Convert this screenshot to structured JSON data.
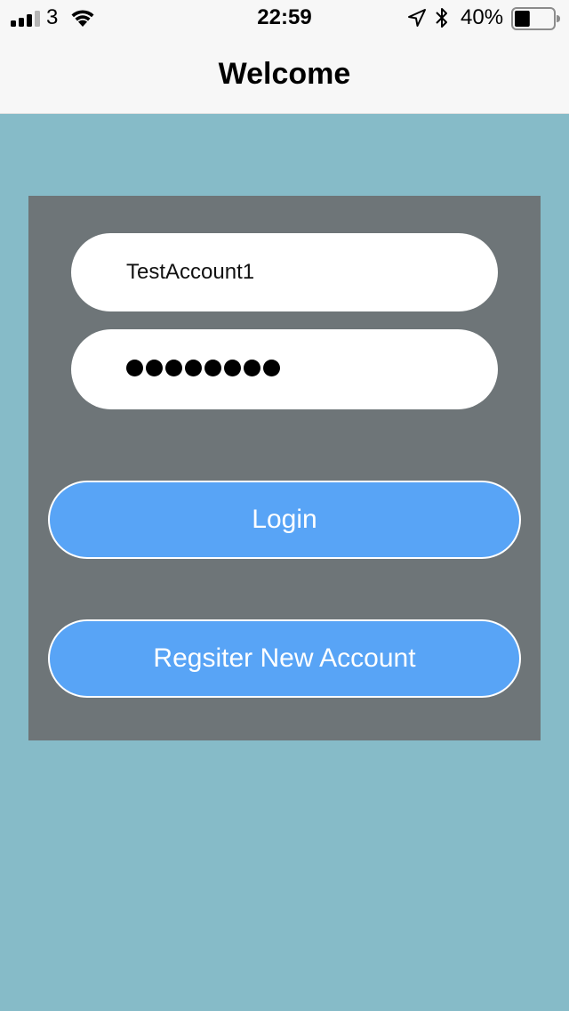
{
  "status_bar": {
    "carrier": "3",
    "time": "22:59",
    "battery_percent": "40%",
    "battery_level": 0.4,
    "icons": [
      "signal-bars-icon",
      "wifi-icon",
      "location-arrow-icon",
      "bluetooth-icon",
      "battery-icon"
    ]
  },
  "nav": {
    "title": "Welcome"
  },
  "form": {
    "username_value": "TestAccount1",
    "password_mask": "●●●●●●●●",
    "password_length": 8
  },
  "buttons": {
    "login_label": "Login",
    "register_label": "Regsiter New Account"
  },
  "colors": {
    "background": "#86bbc8",
    "card": "#6e7578",
    "button": "#58a4f6",
    "nav_bar": "#f7f7f7"
  }
}
